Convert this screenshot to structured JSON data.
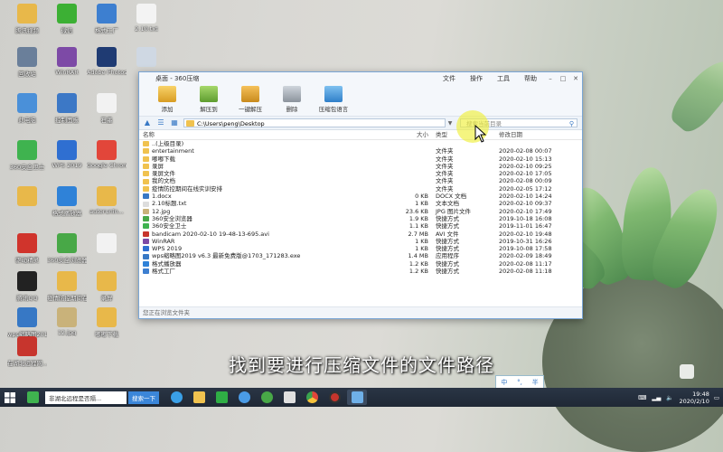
{
  "desktop_icons": [
    {
      "label": "腾讯视频",
      "color": "#e8b84a"
    },
    {
      "label": "微信",
      "color": "#3cb034"
    },
    {
      "label": "格式工厂",
      "color": "#3d7fd0"
    },
    {
      "label": "2.10.txt",
      "color": "#f3f3f3"
    },
    {
      "label": "回收站",
      "color": "#6a7f9a"
    },
    {
      "label": "WinRAR",
      "color": "#7d4aa6"
    },
    {
      "label": "Adobe Photosho...",
      "color": "#1f3b73"
    },
    {
      "label": "",
      "color": "#cfd8e3"
    },
    {
      "label": "此电脑",
      "color": "#4a90d9"
    },
    {
      "label": "控制面板",
      "color": "#3c78c6"
    },
    {
      "label": "石墨",
      "color": "#f2f2f2"
    },
    {
      "label": "360安全卫士",
      "color": "#3fb34f"
    },
    {
      "label": "WPS 2019",
      "color": "#2f6fd1"
    },
    {
      "label": "Google Chrome",
      "color": "#e2463a"
    },
    {
      "label": "",
      "color": "#e8b84a"
    },
    {
      "label": "驱动精灵",
      "color": "#d0342c"
    },
    {
      "label": "格式播放器",
      "color": "#2f82d8"
    },
    {
      "label": "autorunin...",
      "color": "#e8b84a"
    },
    {
      "label": "腾讯QQ",
      "color": "#222222"
    },
    {
      "label": "360安全浏览器",
      "color": "#48a847"
    },
    {
      "label": "",
      "color": "#f2f2f2"
    },
    {
      "label": "wps缩略图2019 v6.3...",
      "color": "#3778c5"
    },
    {
      "label": "疫情防控期间在线实训...",
      "color": "#e8b84a"
    },
    {
      "label": "录屏",
      "color": "#e8b84a"
    },
    {
      "label": "在湖北远程网...",
      "color": "#c7352d"
    },
    {
      "label": "12.jpg",
      "color": "#c9b27a"
    },
    {
      "label": "嘟嘟下载",
      "color": "#e8b84a"
    }
  ],
  "window": {
    "title": "桌面 - 360压缩",
    "menus": [
      "文件",
      "操作",
      "工具",
      "帮助"
    ],
    "toolbar": [
      "添加",
      "解压到",
      "一键解压",
      "删除",
      "压缩包语言"
    ],
    "address": "C:\\Users\\peng\\Desktop",
    "search_placeholder": "搜索当前目录",
    "columns": {
      "name": "名称",
      "size": "大小",
      "type": "类型",
      "date": "修改日期"
    },
    "status": "您正在浏览文件夹",
    "files": [
      {
        "name": "..(上级目录)",
        "size": "",
        "type": "",
        "date": "",
        "icon": "#f0c24f"
      },
      {
        "name": "entertainment",
        "size": "",
        "type": "文件夹",
        "date": "2020-02-08 00:07",
        "icon": "#f0c24f"
      },
      {
        "name": "嘟嘟下载",
        "size": "",
        "type": "文件夹",
        "date": "2020-02-10 15:13",
        "icon": "#f0c24f"
      },
      {
        "name": "录屏",
        "size": "",
        "type": "文件夹",
        "date": "2020-02-10 09:25",
        "icon": "#f0c24f"
      },
      {
        "name": "录屏文件",
        "size": "",
        "type": "文件夹",
        "date": "2020-02-10 17:05",
        "icon": "#f0c24f"
      },
      {
        "name": "我的文档",
        "size": "",
        "type": "文件夹",
        "date": "2020-02-08 00:09",
        "icon": "#f0c24f"
      },
      {
        "name": "疫情防控期间在线实训安排",
        "size": "",
        "type": "文件夹",
        "date": "2020-02-05 17:12",
        "icon": "#f0c24f"
      },
      {
        "name": "1.docx",
        "size": "0 KB",
        "type": "DOCX 文档",
        "date": "2020-02-10 14:24",
        "icon": "#3778c5"
      },
      {
        "name": "2.10标题.txt",
        "size": "1 KB",
        "type": "文本文档",
        "date": "2020-02-10 09:37",
        "icon": "#dddddd"
      },
      {
        "name": "12.jpg",
        "size": "23.6 KB",
        "type": "JPG 图片文件",
        "date": "2020-02-10 17:49",
        "icon": "#c9b27a"
      },
      {
        "name": "360安全浏览器",
        "size": "1.9 KB",
        "type": "快捷方式",
        "date": "2019-10-18 16:08",
        "icon": "#48a847"
      },
      {
        "name": "360安全卫士",
        "size": "1.1 KB",
        "type": "快捷方式",
        "date": "2019-11-01 16:47",
        "icon": "#3fb34f"
      },
      {
        "name": "bandicam 2020-02-10 19-48-13-695.avi",
        "size": "2.7 MB",
        "type": "AVI 文件",
        "date": "2020-02-10 19:48",
        "icon": "#c7352d"
      },
      {
        "name": "WinRAR",
        "size": "1 KB",
        "type": "快捷方式",
        "date": "2019-10-31 16:26",
        "icon": "#7d4aa6"
      },
      {
        "name": "WPS 2019",
        "size": "1 KB",
        "type": "快捷方式",
        "date": "2019-10-08 17:58",
        "icon": "#2f6fd1"
      },
      {
        "name": "wps缩略图2019 v6.3 最新免费版@1703_171283.exe",
        "size": "1.4 MB",
        "type": "应用程序",
        "date": "2020-02-09 18:49",
        "icon": "#3778c5"
      },
      {
        "name": "格式播放器",
        "size": "1.2 KB",
        "type": "快捷方式",
        "date": "2020-02-08 11:17",
        "icon": "#2f82d8"
      },
      {
        "name": "格式工厂",
        "size": "1.2 KB",
        "type": "快捷方式",
        "date": "2020-02-08 11:18",
        "icon": "#3d7fd0"
      }
    ]
  },
  "subtitle": "找到要进行压缩文件的文件路径",
  "ime": {
    "lang": "中",
    "punct": "°,",
    "width": "半"
  },
  "taskbar": {
    "search_text": "非湖北远程是否隔...",
    "search_button": "搜索一下",
    "clock_time": "19:48",
    "clock_date": "2020/2/10"
  },
  "colors": {
    "accent": "#3778c5",
    "window_border": "#7aa6d6",
    "folder": "#f0c24f"
  }
}
